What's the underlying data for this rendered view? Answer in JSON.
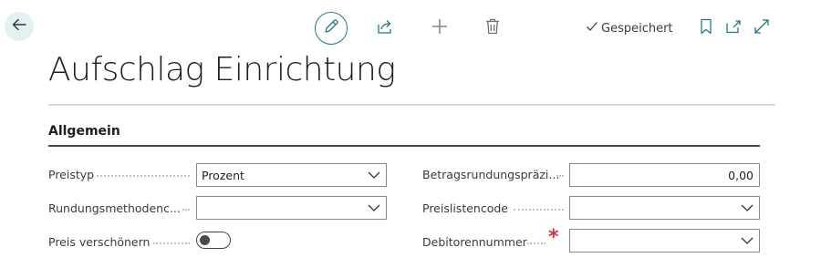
{
  "toolbar": {
    "back_icon": "arrow-left-icon",
    "edit_icon": "pencil-icon",
    "share_icon": "share-icon",
    "new_icon": "plus-icon",
    "delete_icon": "trash-icon",
    "saved_label": "Gespeichert",
    "bookmark_icon": "bookmark-icon",
    "open_new_window_icon": "open-in-new-window-icon",
    "expand_icon": "expand-icon"
  },
  "page": {
    "title": "Aufschlag Einrichtung"
  },
  "section": {
    "title": "Allgemein"
  },
  "fields": {
    "price_type": {
      "label": "Preistyp",
      "value": "Prozent"
    },
    "rounding_method": {
      "label": "Rundungsmethodenc...",
      "value": ""
    },
    "beautify_price": {
      "label": "Preis verschönern",
      "checked": false
    },
    "amount_rounding": {
      "label": "Betragsrundungspräzi...",
      "value": "0,00"
    },
    "price_list_code": {
      "label": "Preislistencode",
      "value": ""
    },
    "customer_no": {
      "label": "Debitorennummer",
      "value": "",
      "required_marker": "*"
    }
  },
  "colors": {
    "accent": "#1e7b85",
    "back_bg": "#e3f1f3",
    "required": "#d13438",
    "section_rule": "#3a4a58"
  }
}
